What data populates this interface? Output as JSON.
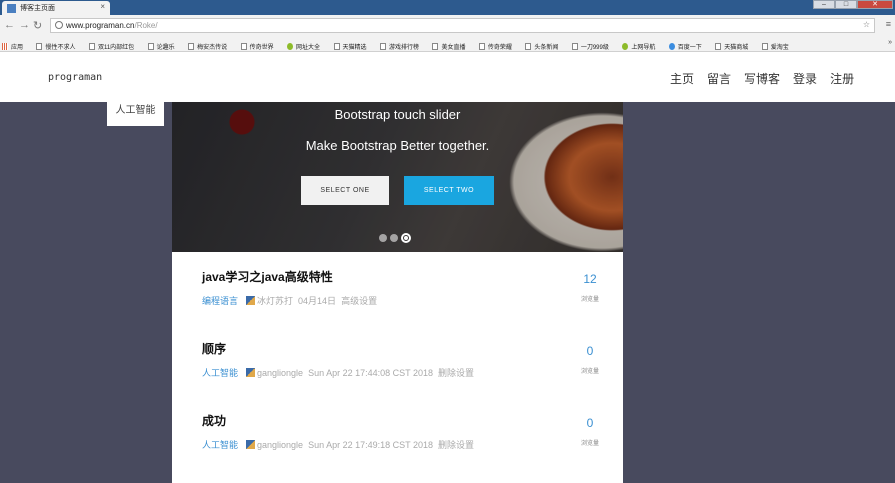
{
  "browser": {
    "tab_title": "博客主页面",
    "url_host": "www.programan.cn",
    "url_path": "/Roke/",
    "win_min": "–",
    "win_close": "✕",
    "bookmarks": [
      "应用",
      "慢性不求人",
      "双11内部红包",
      "论趣乐",
      "梅安杰传说",
      "传奇世界",
      "网址大全",
      "天猫精选",
      "游戏排行榜",
      "美女直播",
      "传奇荣耀",
      "头条新闻",
      "一刀999级",
      "上网导航",
      "百度一下",
      "天猫商城",
      "爱淘宝"
    ]
  },
  "site": {
    "brand": "programan",
    "nav": [
      "主页",
      "留言",
      "写博客",
      "登录",
      "注册"
    ],
    "category_pill": "人工智能"
  },
  "slider": {
    "title": "Bootstrap touch slider",
    "subtitle": "Make Bootstrap Better together.",
    "button_one": "SELECT ONE",
    "button_two": "SELECT TWO"
  },
  "posts": [
    {
      "title": "java学习之java高级特性",
      "category": "编程语言",
      "author": "冰灯苏打",
      "date": "04月14日",
      "action": "高级设置",
      "count": "12",
      "count_label": "浏览量"
    },
    {
      "title": "顺序",
      "category": "人工智能",
      "author": "gangliongle",
      "date": "Sun Apr 22 17:44:08 CST 2018",
      "action": "删除设置",
      "count": "0",
      "count_label": "浏览量"
    },
    {
      "title": "成功",
      "category": "人工智能",
      "author": "gangliongle",
      "date": "Sun Apr 22 17:49:18 CST 2018",
      "action": "删除设置",
      "count": "0",
      "count_label": "浏览量"
    }
  ]
}
